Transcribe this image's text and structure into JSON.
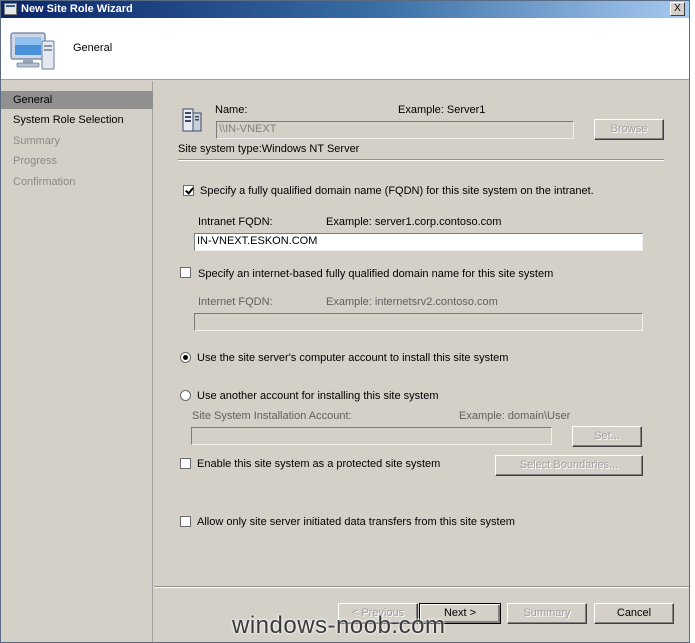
{
  "window": {
    "title": "New Site Role Wizard",
    "close_glyph": "X"
  },
  "header": {
    "page_title": "General",
    "icon": "computer-monitor-icon"
  },
  "nav": {
    "items": [
      {
        "label": "General",
        "state": "active"
      },
      {
        "label": "System Role Selection",
        "state": "enabled"
      },
      {
        "label": "Summary",
        "state": "disabled"
      },
      {
        "label": "Progress",
        "state": "disabled"
      },
      {
        "label": "Confirmation",
        "state": "disabled"
      }
    ]
  },
  "form": {
    "server_icon": "server-icon",
    "name_label": "Name:",
    "name_example": "Example: Server1",
    "name_value": "\\\\IN-VNEXT",
    "browse_label": "Browse",
    "site_system_type": "Site system type:Windows NT Server",
    "fqdn_checkbox_label": "Specify a fully qualified domain name (FQDN) for this site system on the intranet.",
    "fqdn_checked": true,
    "intranet_fqdn_label": "Intranet FQDN:",
    "intranet_fqdn_example": "Example: server1.corp.contoso.com",
    "intranet_fqdn_value": "IN-VNEXT.ESKON.COM",
    "internet_checkbox_label": "Specify an internet-based fully qualified domain name for this site system",
    "internet_checked": false,
    "internet_fqdn_label": "Internet FQDN:",
    "internet_fqdn_example": "Example: internetsrv2.contoso.com",
    "internet_fqdn_value": "",
    "radio_computer_account_label": "Use the site server's computer account to install this site system",
    "radio_computer_account_checked": true,
    "radio_other_account_label": "Use another account for installing this site system",
    "radio_other_account_checked": false,
    "install_account_label": "Site System Installation Account:",
    "install_account_example": "Example: domain\\User",
    "install_account_value": "",
    "set_label": "Set...",
    "protected_checkbox_label": "Enable this site system as a protected site system",
    "protected_checked": false,
    "select_boundaries_label": "Select Boundaries...",
    "initiated_checkbox_label": "Allow only site server initiated data transfers from this site system",
    "initiated_checked": false
  },
  "footer": {
    "previous_label": "< Previous",
    "next_label": "Next >",
    "summary_label": "Summary",
    "cancel_label": "Cancel"
  },
  "watermark": "windows-noob.com",
  "colors": {
    "title_bar_start": "#0a246a",
    "title_bar_end": "#a6caf0",
    "dialog_face": "#d4d0c8",
    "nav_selected": "#909090"
  }
}
